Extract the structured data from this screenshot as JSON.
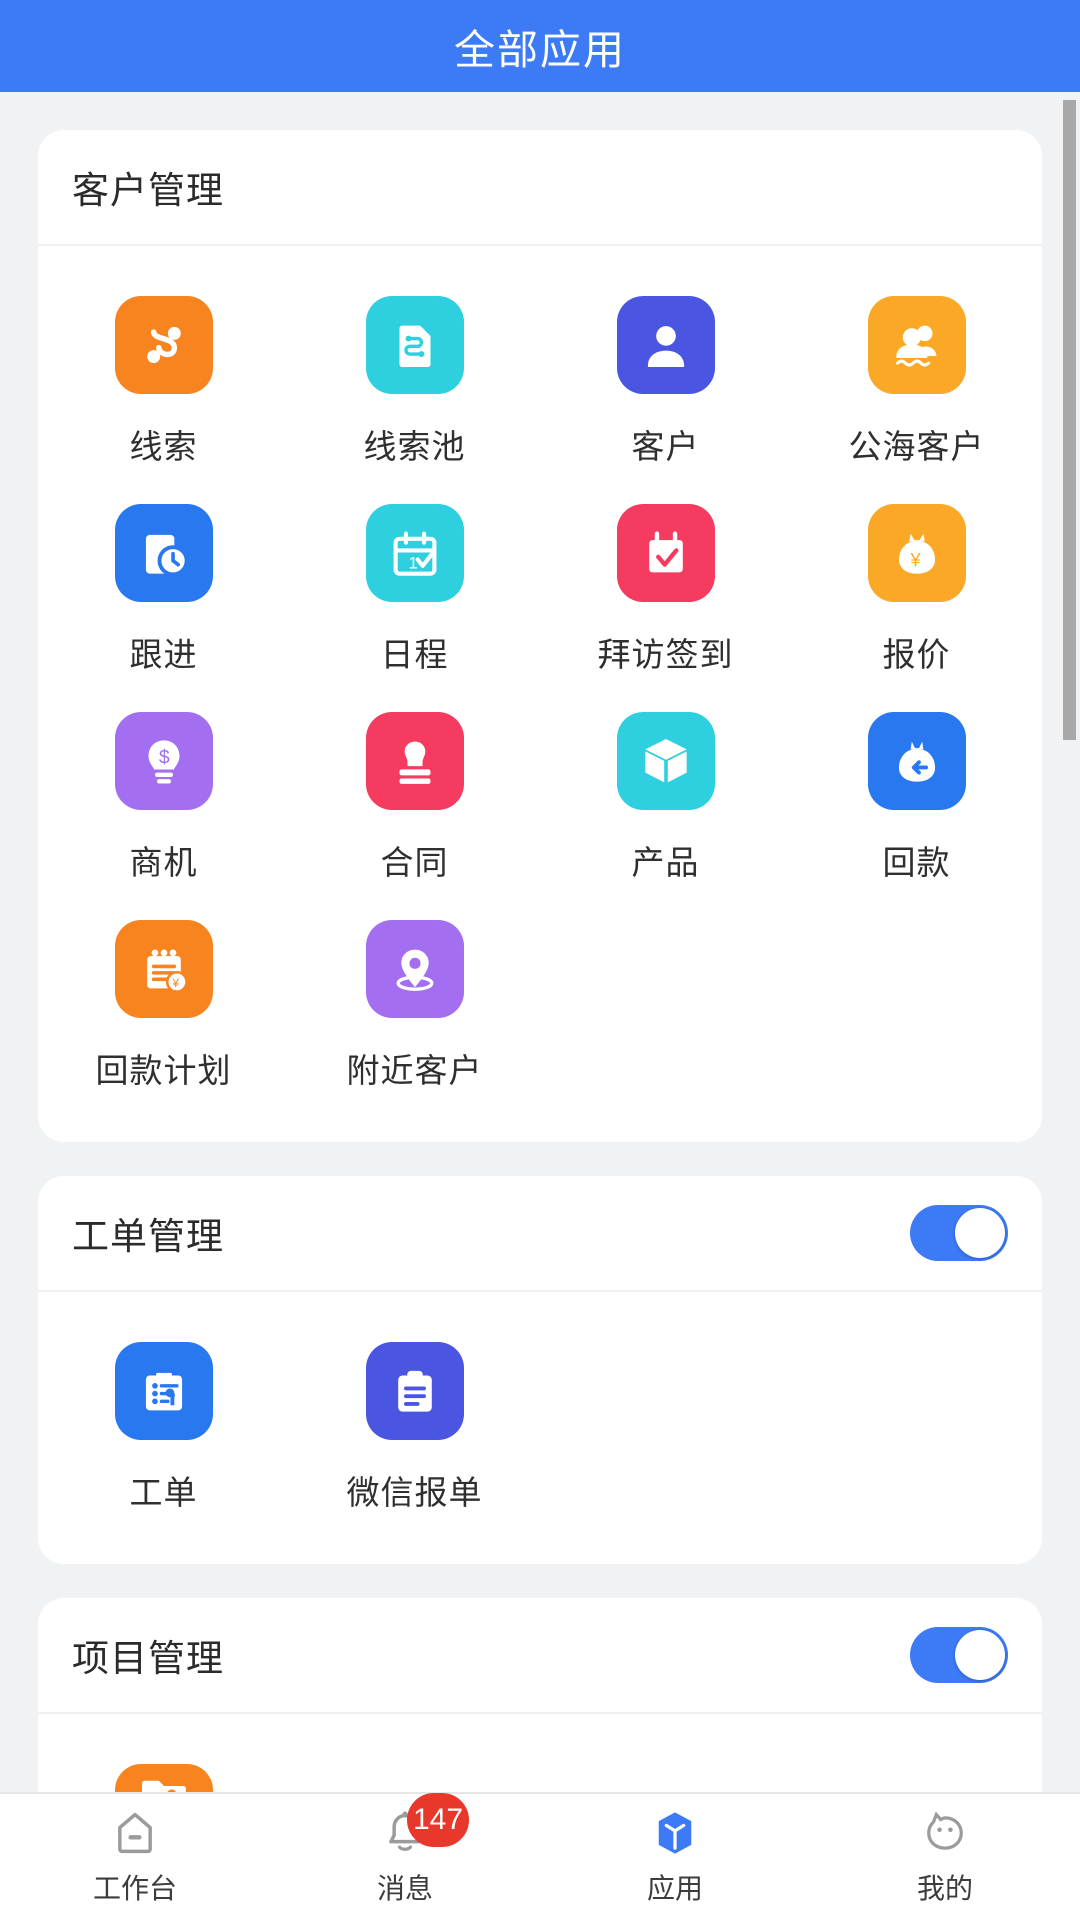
{
  "header": {
    "title": "全部应用",
    "background": "#3d7af5",
    "text_color": "#ffffff"
  },
  "theme": {
    "page_background": "#f1f2f4",
    "card_background": "#ffffff",
    "toggle_on_color": "#3d7af5",
    "badge_color": "#e8372b",
    "active_tab_color": "#3d7af5"
  },
  "sections": [
    {
      "title": "客户管理",
      "has_toggle": false,
      "apps": [
        {
          "label": "线索",
          "icon": "lead-icon",
          "color": "#f7841f"
        },
        {
          "label": "线索池",
          "icon": "lead-pool-icon",
          "color": "#2ecfdf"
        },
        {
          "label": "客户",
          "icon": "customer-icon",
          "color": "#4a56e2"
        },
        {
          "label": "公海客户",
          "icon": "public-customer-icon",
          "color": "#fba827"
        },
        {
          "label": "跟进",
          "icon": "follow-up-icon",
          "color": "#2878f0"
        },
        {
          "label": "日程",
          "icon": "schedule-icon",
          "color": "#2ecfdf"
        },
        {
          "label": "拜访签到",
          "icon": "visit-checkin-icon",
          "color": "#f63b60"
        },
        {
          "label": "报价",
          "icon": "quote-icon",
          "color": "#fba827"
        },
        {
          "label": "商机",
          "icon": "opportunity-icon",
          "color": "#a36ef0"
        },
        {
          "label": "合同",
          "icon": "contract-icon",
          "color": "#f63b60"
        },
        {
          "label": "产品",
          "icon": "product-icon",
          "color": "#2ecfdf"
        },
        {
          "label": "回款",
          "icon": "payment-icon",
          "color": "#2878f0"
        },
        {
          "label": "回款计划",
          "icon": "payment-plan-icon",
          "color": "#f7841f"
        },
        {
          "label": "附近客户",
          "icon": "nearby-customer-icon",
          "color": "#a36ef0"
        }
      ]
    },
    {
      "title": "工单管理",
      "has_toggle": true,
      "toggle_on": true,
      "apps": [
        {
          "label": "工单",
          "icon": "work-order-icon",
          "color": "#2878f0"
        },
        {
          "label": "微信报单",
          "icon": "wechat-report-icon",
          "color": "#4a56e2"
        }
      ]
    },
    {
      "title": "项目管理",
      "has_toggle": true,
      "toggle_on": true,
      "apps": [
        {
          "label": "",
          "icon": "project-share-icon",
          "color": "#f7841f"
        }
      ]
    }
  ],
  "tabbar": {
    "items": [
      {
        "label": "工作台",
        "icon": "home-icon",
        "active": false,
        "badge": ""
      },
      {
        "label": "消息",
        "icon": "bell-icon",
        "active": false,
        "badge": "147"
      },
      {
        "label": "应用",
        "icon": "cube-icon",
        "active": true,
        "badge": ""
      },
      {
        "label": "我的",
        "icon": "profile-icon",
        "active": false,
        "badge": ""
      }
    ]
  }
}
